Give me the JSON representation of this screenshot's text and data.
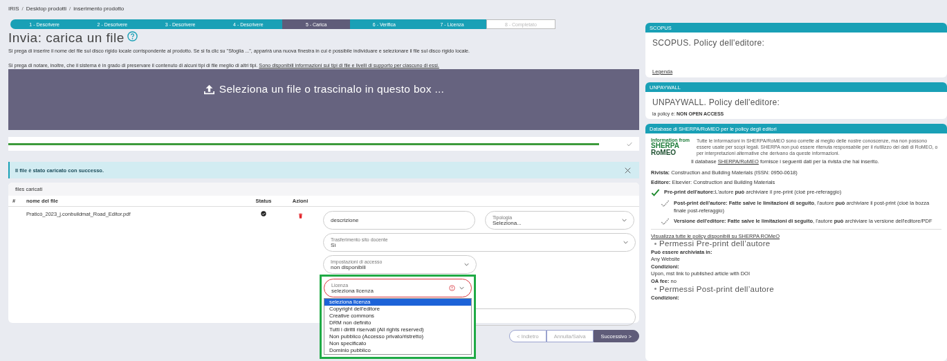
{
  "breadcrumb": {
    "separator": "/",
    "items": [
      "IRIS",
      "Desktop prodotti",
      "inserimento prodotto"
    ]
  },
  "steps": [
    {
      "label": "1 - Descrivere",
      "kind": "done"
    },
    {
      "label": "2 - Descrivere",
      "kind": "done"
    },
    {
      "label": "3 - Descrivere",
      "kind": "done"
    },
    {
      "label": "4 - Descrivere",
      "kind": "done"
    },
    {
      "label": "5 - Carica",
      "kind": "current"
    },
    {
      "label": "6 - Verifica",
      "kind": "done"
    },
    {
      "label": "7 - Licenza",
      "kind": "done"
    },
    {
      "label": "8 - Completato",
      "kind": "pending"
    }
  ],
  "title": "Invia: carica un file",
  "instructions": {
    "line_1": "Si prega di inserire il nome del file sul disco rigido locale corrispondente al prodotto. Se si fa clic su \"Sfoglia ...\", apparirà una nuova finestra in cui è possibile individuare e selezionare il file sul disco rigido locale.",
    "line_2": "Si prega di notare, inoltre, che il sistema è in grado di preservare il contenuto di alcuni tipi di file meglio di altri tipi.",
    "line_2_link": "Sono disponibili informazioni sui tipi di file e livelli di supporto per ciascuno di essi."
  },
  "dropzone": {
    "label": "Seleziona un file o trascinalo in questo box ..."
  },
  "upload_progress": {
    "level": 0.97,
    "complete": true
  },
  "alert": {
    "message": "Il file è stato caricato con successo."
  },
  "files": {
    "title": "files caricati",
    "columns": [
      "#",
      "nome del file",
      "Status",
      "Azioni"
    ],
    "rows": [
      {
        "name": "Praticò_2023_j.conbuildmat_Road_Editor.pdf",
        "uploaded": true
      }
    ]
  },
  "form": {
    "description": {
      "placeholder": "descrizione"
    },
    "tipologia": {
      "label": "Tipologia",
      "value": "Seleziona..."
    },
    "trasferimento": {
      "label": "Trasferimento sito docente",
      "value": "Sì"
    },
    "accesso": {
      "label": "Impostazioni di accesso",
      "value": "non disponibili"
    },
    "licenza": {
      "label": "Licenza",
      "value": "seleziona licenza",
      "error": true,
      "highlighted": true,
      "expanded": true,
      "options": [
        {
          "label": "seleziona licenza",
          "selected": true
        },
        {
          "label": "Copyright dell'editore",
          "selected": false
        },
        {
          "label": "Creative commons",
          "selected": false
        },
        {
          "label": "DRM non definito",
          "selected": false
        },
        {
          "label": "Tutti i diritti riservati (All rights reserved)",
          "selected": false
        },
        {
          "label": "Non pubblico (Accesso privato/ristretto)",
          "selected": false
        },
        {
          "label": "Non specificato",
          "selected": false
        },
        {
          "label": "Dominio pubblico",
          "selected": false
        }
      ]
    }
  },
  "buttons": [
    {
      "label": "< Indietro",
      "kind": "secondary",
      "disabled": true
    },
    {
      "label": "Annulla/Salva",
      "kind": "secondary",
      "disabled": true
    },
    {
      "label": "Successivo >",
      "kind": "primary",
      "disabled": false
    }
  ],
  "scopus": {
    "header": "SCOPUS",
    "title": "SCOPUS. Policy dell'editore:",
    "link": "Legenda"
  },
  "unpaywall": {
    "header": "UNPAYWALL",
    "title": "UNPAYWALL. Policy dell'editore:",
    "policy": "la policy è: **NON OPEN ACCESS**"
  },
  "sherpa": {
    "header": "Database di SHERPA/RoMEO per le policy degli editori",
    "logo": [
      "Information from",
      "SHERPA",
      "RoMEO"
    ],
    "disclaimer": "Tutte le informazioni in SHERPA/RoMEO sono corrette al meglio delle nostre conoscenze, ma non possono essere usate per scopi legali. SHERPA non può essere ritenuta responsabile per il riutilizzo dei dati di RoMEO, o per interpretazioni alternative che derivano da queste informazioni.",
    "intro_before": "Il database",
    "intro_link": "SHERPA/RoMEO",
    "intro_after": "fornisce i seguenti dati per la rivista che hai inserito.",
    "journal": "**Rivista:** Construction and Building Materials (ISSN: 0950-0618)",
    "publisher": "**Editore:** Elsevier: Construction and Building Materials",
    "policies": [
      {
        "kind": "allowed",
        "text": "**Pre-print dell'autore:**L'autore **può** archiviare il pre-print (cioè pre-referaggio)"
      },
      {
        "kind": "restricted",
        "text": "**Post-print dell'autore: Fatte salve le limitazioni di seguito**, l'autore **può** archiviare il post-print (cioè la bozza finale post-referaggio)"
      },
      {
        "kind": "restricted",
        "text": "**Versione dell'editore: Fatte salve le limitazioni di seguito**, l'autore **può** archiviare la versione dell'editore/PDF"
      }
    ],
    "all_policies_link": "Visualizza tutte le policy disponibili su SHERPA ROMeO",
    "sections": [
      {
        "heading": "Permessi Pre-print dell’autore",
        "entries": [
          {
            "kind": "pair",
            "label": "Può essere archiviata in:",
            "value": "Any Website"
          },
          {
            "kind": "pair",
            "label": "Condizioni:",
            "value": "Upon, mst link to published article with DOI"
          },
          {
            "kind": "inline",
            "text": "**OA fee:** no"
          }
        ]
      },
      {
        "heading": "Permessi Post-print dell’autore",
        "entries": [
          {
            "kind": "pair",
            "label": "Condizioni:"
          }
        ]
      }
    ]
  }
}
